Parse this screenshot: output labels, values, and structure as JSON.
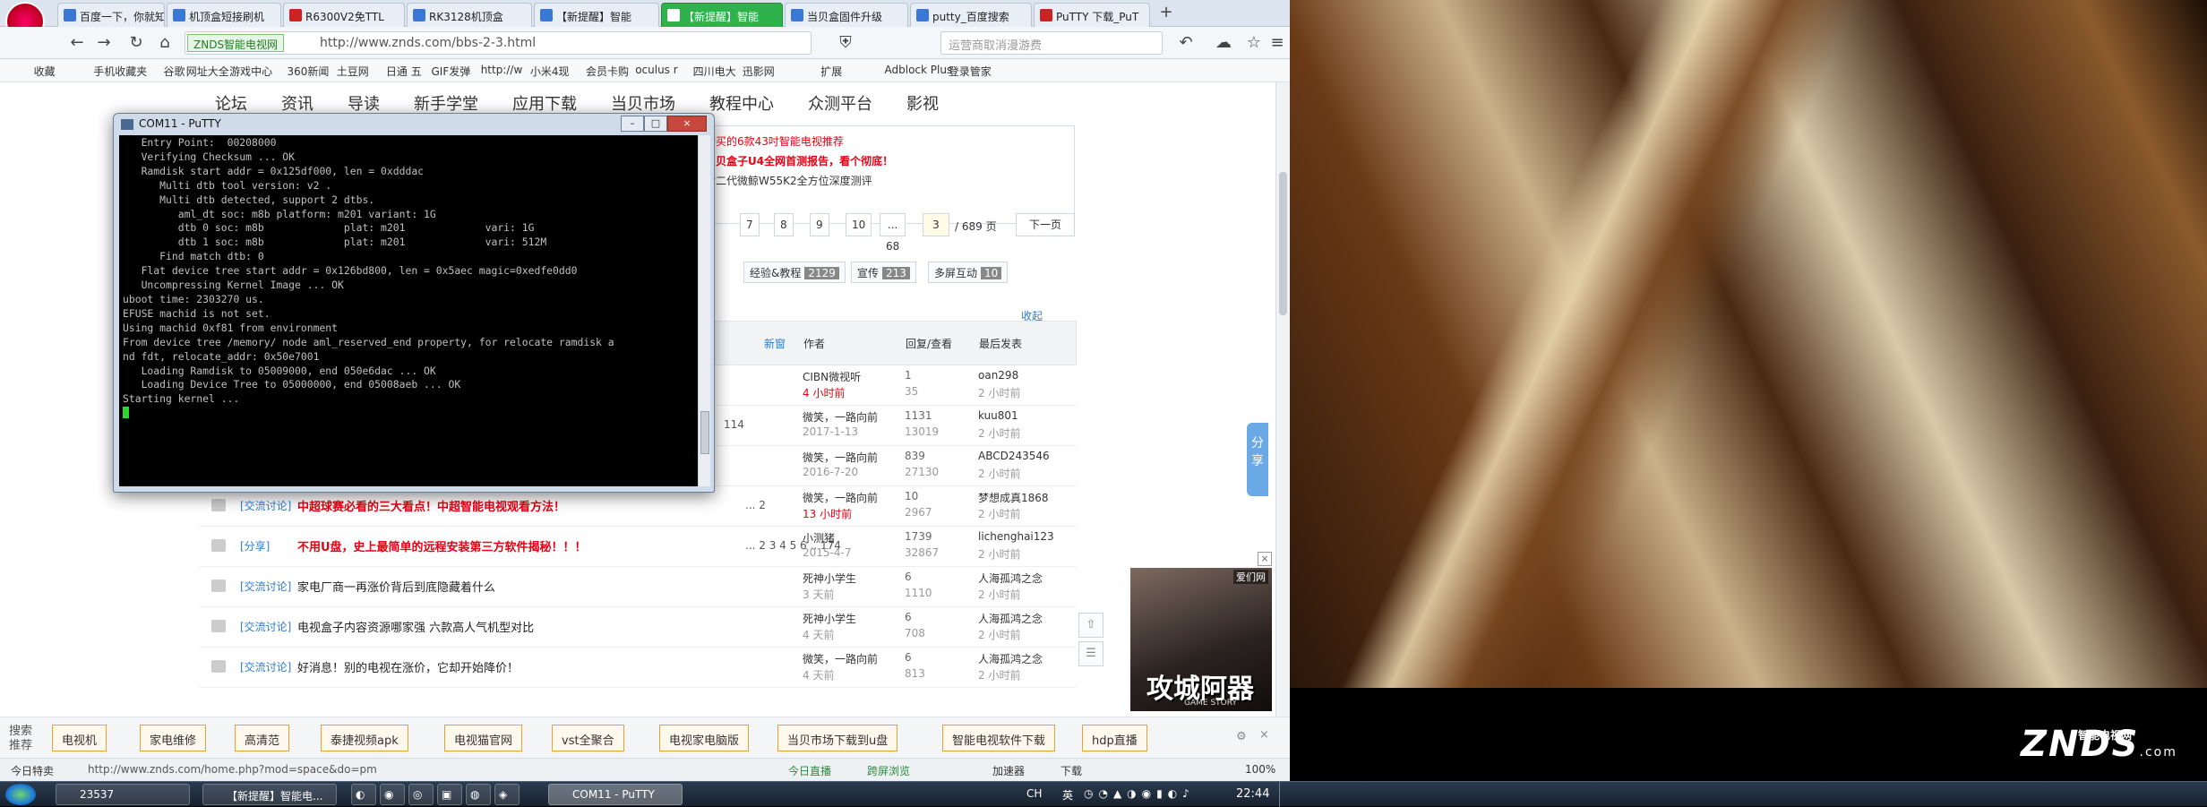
{
  "tabs": [
    {
      "label": "百度一下，你就知道"
    },
    {
      "label": "机顶盒短接刷机"
    },
    {
      "label": "R6300V2免TTL"
    },
    {
      "label": "RK3128机顶盒"
    },
    {
      "label": "【新提醒】智能"
    },
    {
      "label": "【新提醒】智能"
    },
    {
      "label": "当贝盒固件升级"
    },
    {
      "label": "putty_百度搜索"
    },
    {
      "label": "PuTTY 下载_PuT"
    }
  ],
  "address": {
    "badge": "ZNDS智能电视网",
    "protocol_hint": "http://",
    "url": "http://www.znds.com/bbs-2-3.html",
    "search_placeholder": "运营商取消漫游费"
  },
  "bookmarks": [
    "收藏",
    "手机收藏夹",
    "谷歌",
    "网址大全",
    "游戏中心",
    "360新闻",
    "土豆网",
    "日通 五",
    "GIF发弹",
    "http://w",
    "小米4现",
    "会员卡购",
    "oculus r",
    "四川电大",
    "迅影网",
    "扩展",
    "Adblock Plus",
    "登录管家"
  ],
  "topnav": [
    "论坛",
    "资讯",
    "导读",
    "新手学堂",
    "应用下载",
    "当贝市场",
    "教程中心",
    "众测平台",
    "影视"
  ],
  "promo": {
    "l1": "购买的6款43吋智能电视推荐",
    "l2": "当贝盒子U4全网首测报告，看个彻底！",
    "l3": "对二代微鲸W55K2全方位深度测评"
  },
  "pager": {
    "pages": [
      "7",
      "8",
      "9",
      "10",
      "... 68"
    ],
    "current": "3",
    "total": "/ 689 页",
    "next": "下一页"
  },
  "cats": [
    {
      "label": "经验&教程",
      "count": "2129"
    },
    {
      "label": "宣传",
      "count": "213"
    },
    {
      "label": "多屏互动",
      "count": "10"
    }
  ],
  "collapse": "收起",
  "list_header": {
    "newest": "新窗",
    "author": "作者",
    "replies": "回复/查看",
    "last": "最后发表"
  },
  "rows": [
    {
      "tag": "",
      "title": "",
      "red": false,
      "pages": "",
      "author": "CIBN微视听",
      "atime": "4 小时前",
      "ared": true,
      "rep": "1",
      "view": "35",
      "last": "oan298",
      "ltime": "2 小时前"
    },
    {
      "tag": "",
      "title": "",
      "red": false,
      "pages": "114",
      "author": "微笑，一路向前",
      "atime": "2017-1-13",
      "ared": false,
      "rep": "1131",
      "view": "13019",
      "last": "kuu801",
      "ltime": "2 小时前"
    },
    {
      "tag": "",
      "title": "",
      "red": false,
      "pages": "",
      "author": "微笑，一路向前",
      "atime": "2016-7-20",
      "ared": false,
      "rep": "839",
      "view": "27130",
      "last": "ABCD243546",
      "ltime": "2 小时前"
    },
    {
      "tag": "[交流讨论]",
      "title": "中超球赛必看的三大看点！中超智能电视观看方法！",
      "red": true,
      "pages": "... 2",
      "author": "微笑，一路向前",
      "atime": "13 小时前",
      "ared": true,
      "rep": "10",
      "view": "2967",
      "last": "梦想成真1868",
      "ltime": "2 小时前"
    },
    {
      "tag": "[分享]",
      "title": "不用U盘，史上最简单的远程安装第三方软件揭秘！！！",
      "red": true,
      "pages": "... 2 3 4 5 6 .. 174",
      "author": "小测猪",
      "atime": "2015-4-7",
      "ared": false,
      "rep": "1739",
      "view": "32867",
      "last": "lichenghai123",
      "ltime": "2 小时前"
    },
    {
      "tag": "[交流讨论]",
      "title": "家电厂商一再涨价背后到底隐藏着什么",
      "red": false,
      "pages": "",
      "author": "死神小学生",
      "atime": "3 天前",
      "ared": false,
      "rep": "6",
      "view": "1110",
      "last": "人海孤鸿之念",
      "ltime": "2 小时前"
    },
    {
      "tag": "[交流讨论]",
      "title": "电视盒子内容资源哪家强 六款高人气机型对比",
      "red": false,
      "pages": "",
      "author": "死神小学生",
      "atime": "4 天前",
      "ared": false,
      "rep": "6",
      "view": "708",
      "last": "人海孤鸿之念",
      "ltime": "2 小时前"
    },
    {
      "tag": "[交流讨论]",
      "title": "好消息！别的电视在涨价，它却开始降价！",
      "red": false,
      "pages": "",
      "author": "微笑，一路向前",
      "atime": "4 天前",
      "ared": false,
      "rep": "6",
      "view": "813",
      "last": "人海孤鸿之念",
      "ltime": "2 小时前"
    }
  ],
  "share": "分享",
  "ad": {
    "label": "爱们网",
    "title": "攻城阿器",
    "sub": "GAME STORY"
  },
  "hotbar": {
    "label": "搜索推荐",
    "items": [
      "电视机",
      "家电维修",
      "高清范",
      "泰捷视频apk",
      "电视猫官网",
      "vst全聚合",
      "电视家电脑版",
      "当贝市场下载到u盘",
      "智能电视软件下载",
      "hdp直播"
    ]
  },
  "status": {
    "left": "今日特卖",
    "url": "http://www.znds.com/home.php?mod=space&do=pm",
    "s1": "今日直播",
    "s2": "跨屏浏览",
    "s3": "加速器",
    "s4": "下载",
    "zoom": "100%"
  },
  "putty": {
    "title": "COM11 - PuTTY",
    "lines": [
      "   Entry Point:  00208000",
      "   Verifying Checksum ... OK",
      "   Ramdisk start addr = 0x125df000, len = 0xdddac",
      "      Multi dtb tool version: v2 .",
      "      Multi dtb detected, support 2 dtbs.",
      "         aml_dt soc: m8b platform: m201 variant: 1G",
      "         dtb 0 soc: m8b             plat: m201             vari: 1G",
      "",
      "         dtb 1 soc: m8b             plat: m201             vari: 512M",
      "",
      "      Find match dtb: 0",
      "   Flat device tree start addr = 0x126bd800, len = 0x5aec magic=0xedfe0dd0",
      "   Uncompressing Kernel Image ... OK",
      "uboot time: 2303270 us.",
      "EFUSE machid is not set.",
      "Using machid 0xf81 from environment",
      "From device tree /memory/ node aml_reserved_end property, for relocate ramdisk a",
      "nd fdt, relocate_addr: 0x50e7001",
      "   Loading Ramdisk to 05009000, end 050e6dac ... OK",
      "   Loading Device Tree to 05000000, end 05008aeb ... OK",
      "",
      "Starting kernel ...",
      ""
    ]
  },
  "taskbar": [
    {
      "label": "23537"
    },
    {
      "label": "【新提醒】智能电..."
    },
    {
      "label": "COM11 - PuTTY"
    }
  ],
  "tray": {
    "ime": "CH",
    "lang": "英",
    "time": "22:44"
  },
  "watermark": {
    "brand": "ZNDS",
    "domain": ".com",
    "sub": "智能电视网"
  }
}
